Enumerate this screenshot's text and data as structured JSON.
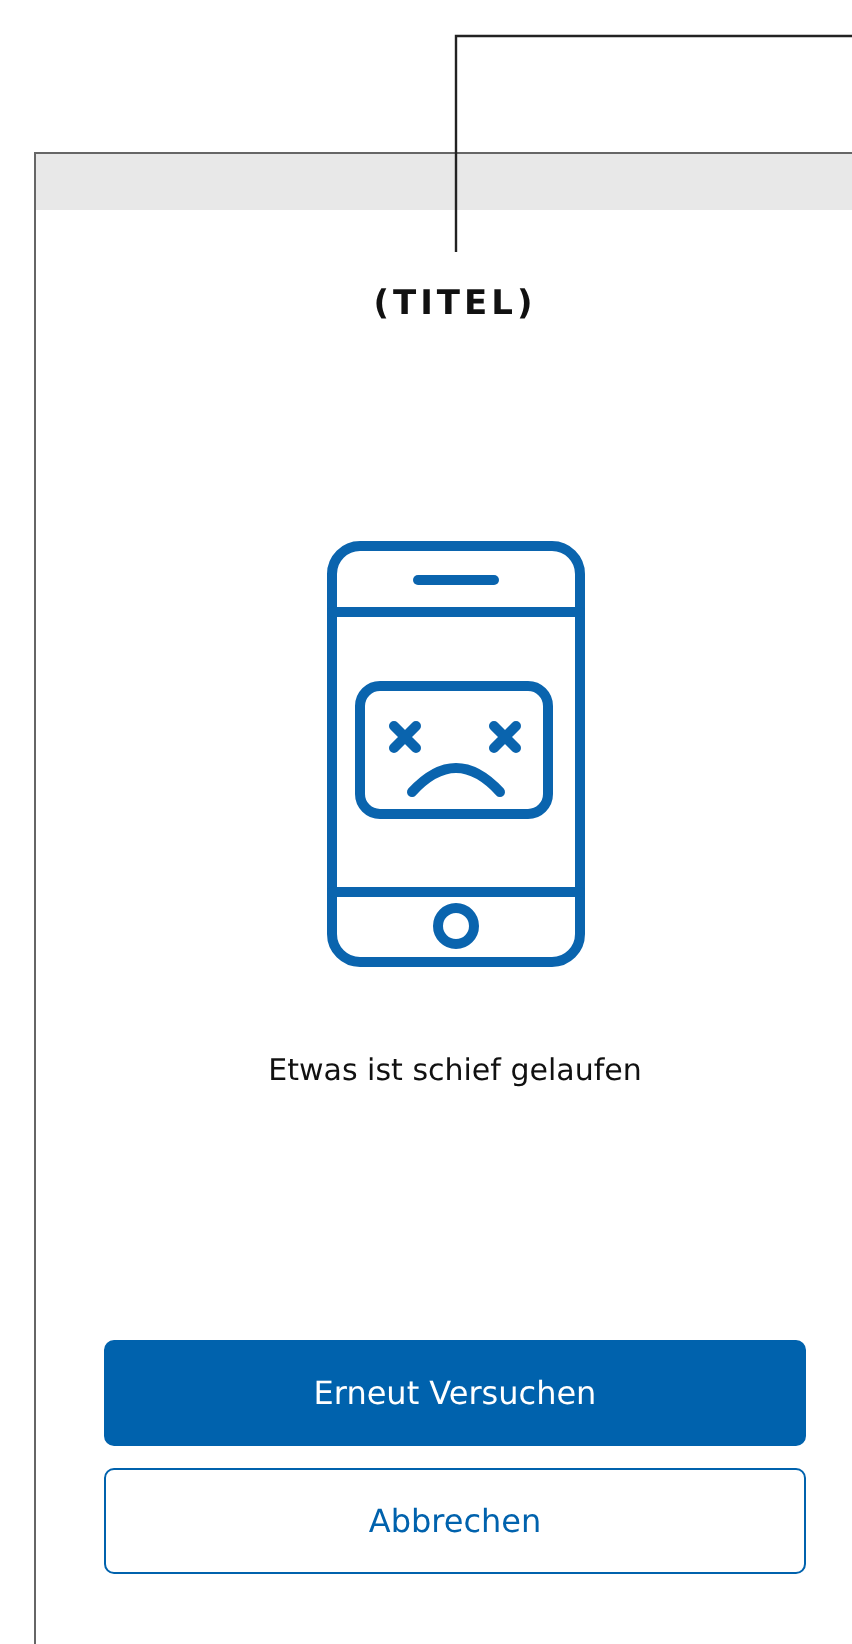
{
  "screen": {
    "title": "(TITEL)",
    "message": "Etwas ist schief gelaufen"
  },
  "buttons": [
    {
      "label": "Erneut Versuchen",
      "kind": "primary"
    },
    {
      "label": "Abbrechen",
      "kind": "secondary"
    }
  ]
}
